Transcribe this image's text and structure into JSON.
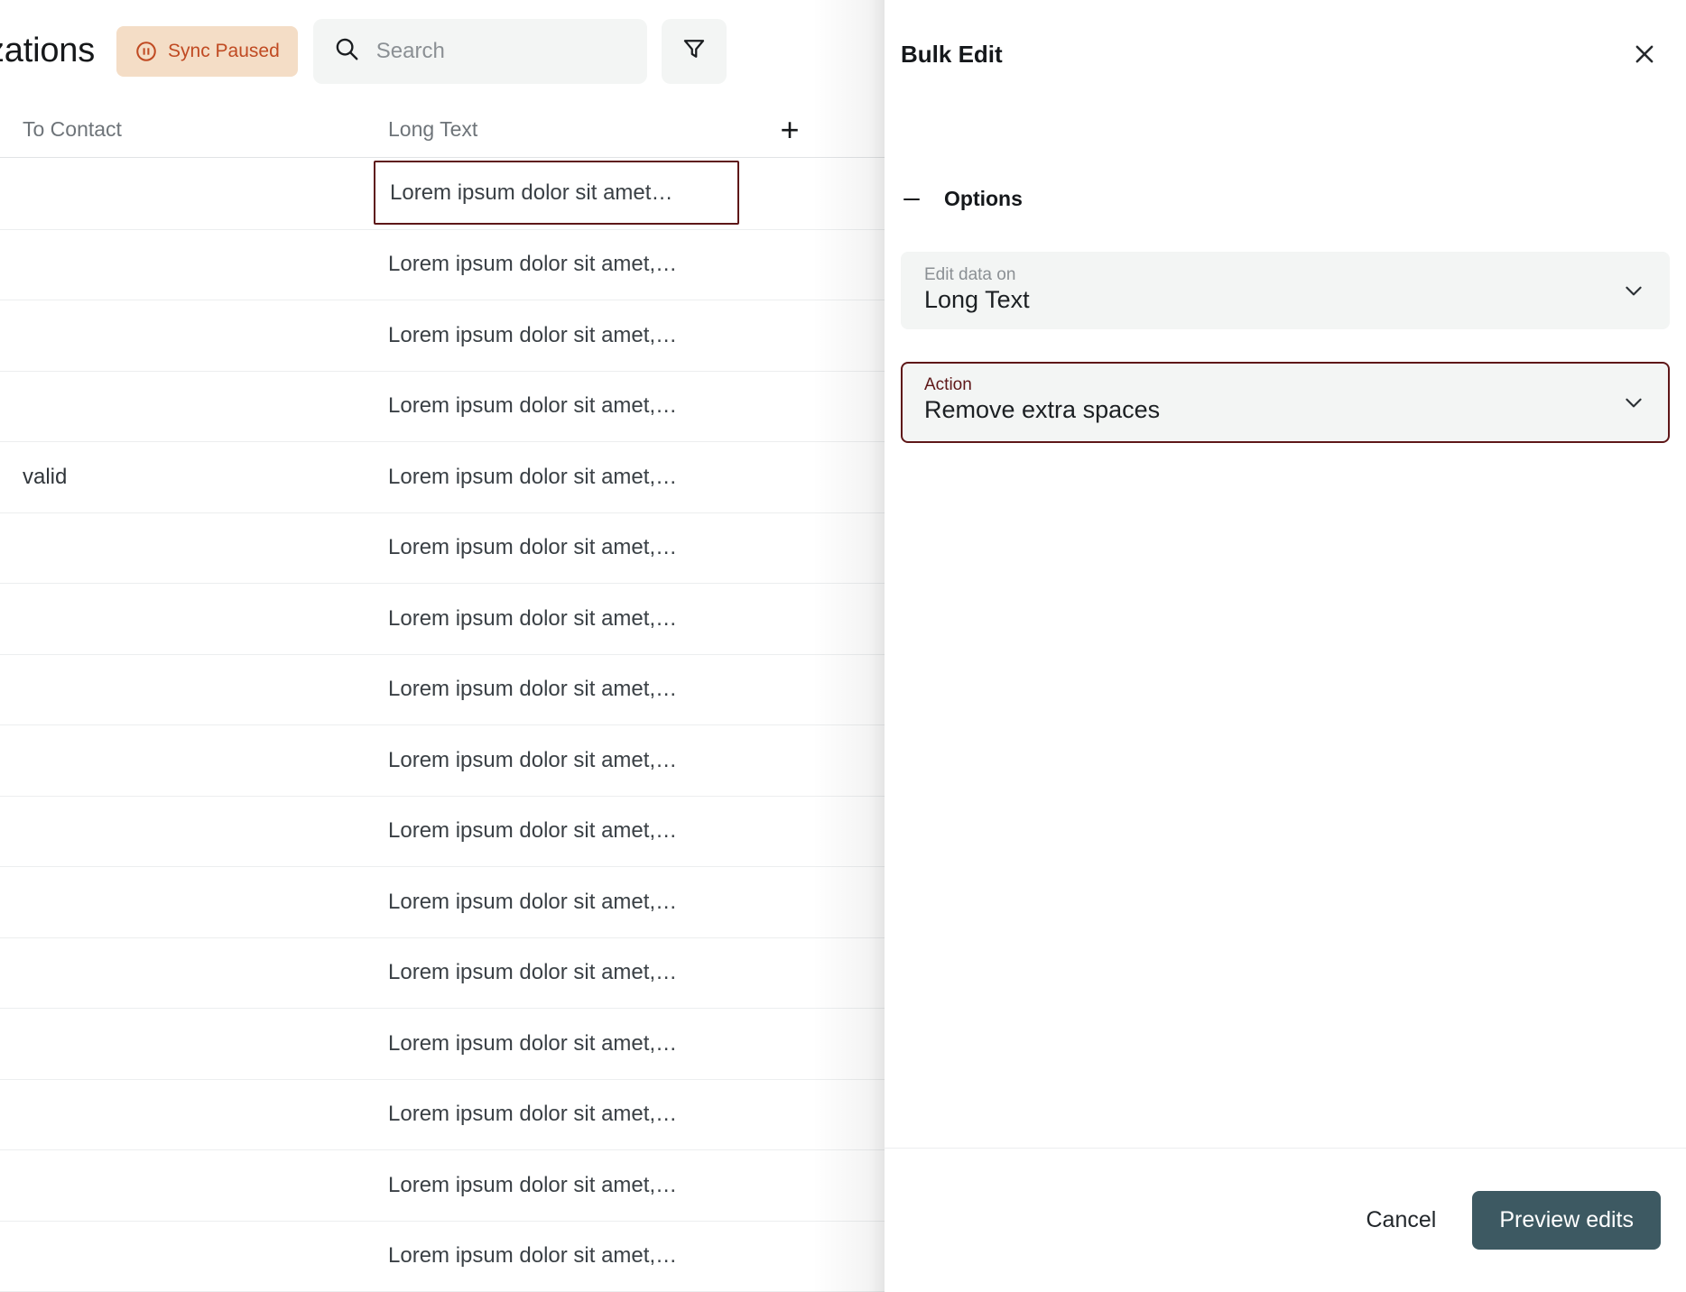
{
  "toolbar": {
    "page_title": "zations",
    "sync_badge": {
      "label": "Sync Paused",
      "icon": "pause-circle-icon",
      "bg": "#f4ddc6",
      "fg": "#c04a22"
    },
    "search": {
      "placeholder": "Search",
      "value": "",
      "icon": "search-icon"
    },
    "filter": {
      "icon": "filter-funnel-icon"
    }
  },
  "table": {
    "columns": [
      {
        "label": "To Contact"
      },
      {
        "label": "Long Text"
      }
    ],
    "add_column_label": "+",
    "rows": [
      {
        "contact": "",
        "long_text": "Lorem ipsum dolor sit amet…",
        "selected": true
      },
      {
        "contact": "",
        "long_text": "Lorem ipsum dolor sit amet,…",
        "selected": false
      },
      {
        "contact": "",
        "long_text": "Lorem ipsum dolor sit amet,…",
        "selected": false
      },
      {
        "contact": "",
        "long_text": "Lorem ipsum dolor sit amet,…",
        "selected": false
      },
      {
        "contact": "valid",
        "long_text": "Lorem ipsum dolor sit amet,…",
        "selected": false
      },
      {
        "contact": "",
        "long_text": "Lorem ipsum dolor sit amet,…",
        "selected": false
      },
      {
        "contact": "",
        "long_text": "Lorem ipsum dolor sit amet,…",
        "selected": false
      },
      {
        "contact": "",
        "long_text": "Lorem ipsum dolor sit amet,…",
        "selected": false
      },
      {
        "contact": "",
        "long_text": "Lorem ipsum dolor sit amet,…",
        "selected": false
      },
      {
        "contact": "",
        "long_text": "Lorem ipsum dolor sit amet,…",
        "selected": false
      },
      {
        "contact": "",
        "long_text": "Lorem ipsum dolor sit amet,…",
        "selected": false
      },
      {
        "contact": "",
        "long_text": "Lorem ipsum dolor sit amet,…",
        "selected": false
      },
      {
        "contact": "",
        "long_text": "Lorem ipsum dolor sit amet,…",
        "selected": false
      },
      {
        "contact": "",
        "long_text": "Lorem ipsum dolor sit amet,…",
        "selected": false
      },
      {
        "contact": "",
        "long_text": "Lorem ipsum dolor sit amet,…",
        "selected": false
      },
      {
        "contact": "",
        "long_text": "Lorem ipsum dolor sit amet,…",
        "selected": false
      }
    ]
  },
  "drawer": {
    "title": "Bulk Edit",
    "close_icon": "close-icon",
    "options": {
      "label": "Options",
      "collapse_icon": "minus-icon",
      "fields": [
        {
          "label": "Edit data on",
          "value": "Long Text",
          "focused": false
        },
        {
          "label": "Action",
          "value": "Remove extra spaces",
          "focused": true
        }
      ]
    },
    "footer": {
      "cancel_label": "Cancel",
      "primary_label": "Preview edits",
      "primary_color": "#3d5962"
    }
  }
}
